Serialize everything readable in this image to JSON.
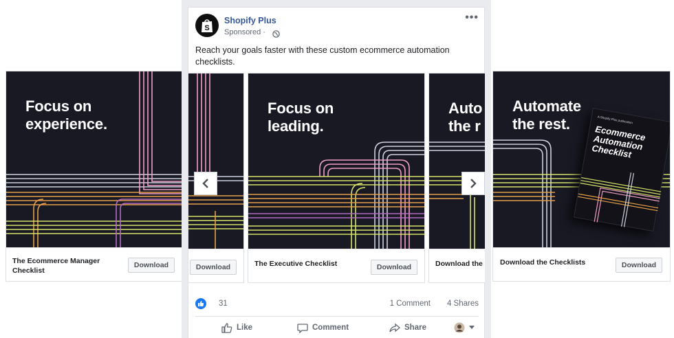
{
  "post": {
    "page_name": "Shopify Plus",
    "sponsored": "Sponsored ·",
    "more": "•••",
    "caption": "Reach your goals faster with these custom ecommerce automation checklists.",
    "reactions": {
      "likes": "31",
      "comments": "1 Comment",
      "shares": "4 Shares"
    },
    "actions": {
      "like": "Like",
      "comment": "Comment",
      "share": "Share"
    }
  },
  "cards": {
    "experience": {
      "headline_1": "Focus on",
      "headline_2": "experience.",
      "cta_1": "The Ecommerce Manager",
      "cta_2": "Checklist",
      "button": "Download"
    },
    "partial_left": {
      "button": "Download"
    },
    "leading": {
      "headline_1": "Focus on",
      "headline_2": "leading.",
      "cta": "The Executive Checklist",
      "button": "Download"
    },
    "partial_right": {
      "headline_1": "Auto",
      "headline_2": "the r",
      "cta": "Download the"
    },
    "automate": {
      "headline_1": "Automate",
      "headline_2": "the rest.",
      "cta": "Download the Checklists",
      "button": "Download",
      "book_kicker": "A Shopify Plus publication",
      "book_title_1": "Ecommerce",
      "book_title_2": "Automation",
      "book_title_3": "Checklist"
    }
  },
  "colors": {
    "art_bg": "#191924",
    "link_blue": "#365899",
    "like_blue": "#1877f2",
    "line_colors": [
      "#e8a04a",
      "#d7e36a",
      "#f2a0c8",
      "#cfd2e0",
      "#b46ac8"
    ]
  },
  "icons": [
    "shopify-bag-icon",
    "globe-icon",
    "more-icon",
    "chevron-left-icon",
    "chevron-right-icon",
    "like-reaction-icon",
    "thumbs-up-icon",
    "comment-icon",
    "share-icon",
    "profile-avatar-icon",
    "caret-down-icon"
  ]
}
